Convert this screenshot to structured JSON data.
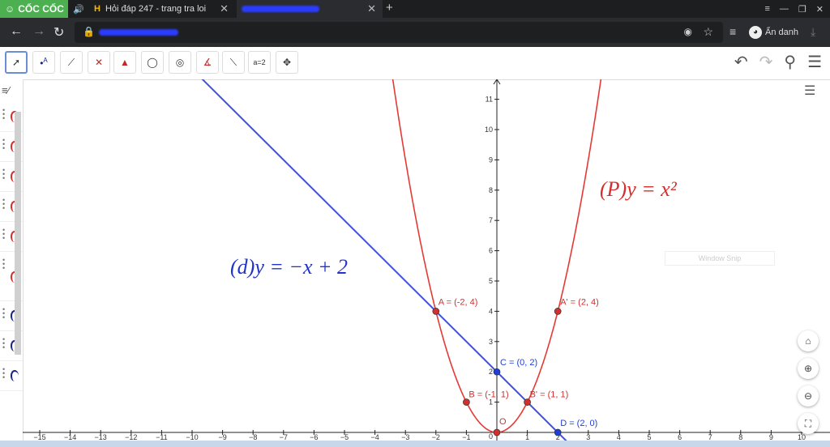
{
  "browser": {
    "brand": "CỐC CỐC",
    "tabs": [
      {
        "label": "Hỏi đáp 247 - trang tra loi"
      },
      {
        "label": ""
      }
    ],
    "incognito_label": "Ẩn danh"
  },
  "toolbar": {
    "tools": [
      "move-tool",
      "point-tool",
      "line-tool",
      "perpendicular-tool",
      "polygon-tool",
      "circle-tool",
      "conic-tool",
      "angle-tool",
      "reflect-tool",
      "slider-tool",
      "move-view-tool"
    ],
    "slider_label": "a=2"
  },
  "overlay": {
    "window_snip": "Window Snip"
  },
  "chart_data": {
    "type": "line",
    "title": "",
    "xlabel": "",
    "ylabel": "",
    "xlim": [
      -15.5,
      10.5
    ],
    "ylim": [
      -0.15,
      11.6
    ],
    "x_ticks": [
      -15,
      -14,
      -13,
      -12,
      -11,
      -10,
      -9,
      -8,
      -7,
      -6,
      -5,
      -4,
      -3,
      -2,
      -1,
      1,
      2,
      3,
      4,
      5,
      6,
      7,
      8,
      9,
      10
    ],
    "y_ticks": [
      1,
      2,
      3,
      4,
      5,
      6,
      7,
      8,
      9,
      10,
      11
    ],
    "origin_label": "0",
    "series": [
      {
        "name": "(P) y = x²",
        "color": "#e53935",
        "kind": "parabola"
      },
      {
        "name": "(d) y = −x + 2",
        "color": "#3f51e0",
        "kind": "line"
      }
    ],
    "labels": {
      "parabola": "(P)y = x²",
      "line": "(d)y = −x + 2"
    },
    "points": [
      {
        "label": "A = (-2, 4)",
        "x": -2,
        "y": 4,
        "color": "#d32f2f"
      },
      {
        "label": "A' = (2, 4)",
        "x": 2,
        "y": 4,
        "color": "#d32f2f"
      },
      {
        "label": "B = (-1, 1)",
        "x": -1,
        "y": 1,
        "color": "#d32f2f"
      },
      {
        "label": "B' = (1, 1)",
        "x": 1,
        "y": 1,
        "color": "#d32f2f"
      },
      {
        "label": "C = (0, 2)",
        "x": 0,
        "y": 2,
        "color": "#1e3fd8"
      },
      {
        "label": "D = (2, 0)",
        "x": 2,
        "y": 0,
        "color": "#1e3fd8"
      },
      {
        "label": "O",
        "x": 0,
        "y": 0,
        "color": "#d32f2f"
      }
    ]
  }
}
